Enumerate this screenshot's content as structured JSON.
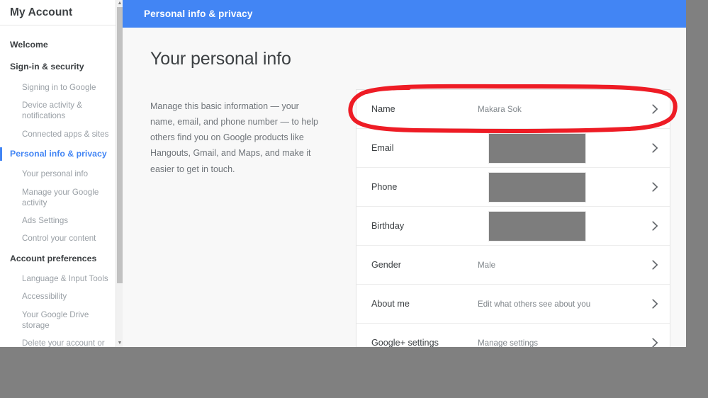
{
  "sidebar": {
    "brand": "My Account",
    "items": [
      {
        "label": "Welcome",
        "type": "group",
        "active": false
      },
      {
        "label": "Sign-in & security",
        "type": "group",
        "active": false
      },
      {
        "label": "Signing in to Google",
        "type": "sub"
      },
      {
        "label": "Device activity & notifications",
        "type": "sub"
      },
      {
        "label": "Connected apps & sites",
        "type": "sub"
      },
      {
        "label": "Personal info & privacy",
        "type": "group",
        "active": true
      },
      {
        "label": "Your personal info",
        "type": "sub"
      },
      {
        "label": "Manage your Google activity",
        "type": "sub"
      },
      {
        "label": "Ads Settings",
        "type": "sub"
      },
      {
        "label": "Control your content",
        "type": "sub"
      },
      {
        "label": "Account preferences",
        "type": "group",
        "active": false
      },
      {
        "label": "Language & Input Tools",
        "type": "sub"
      },
      {
        "label": "Accessibility",
        "type": "sub"
      },
      {
        "label": "Your Google Drive storage",
        "type": "sub"
      },
      {
        "label": "Delete your account or services",
        "type": "sub"
      }
    ],
    "scroll_up_glyph": "▲",
    "scroll_down_glyph": "▼"
  },
  "topbar": {
    "title": "Personal info & privacy",
    "background": "#4285f4"
  },
  "main": {
    "page_title": "Your personal info",
    "intro": "Manage this basic information — your name, email, and phone number — to help others find you on Google products like Hangouts, Gmail, and Maps, and make it easier to get in touch."
  },
  "card": {
    "rows": [
      {
        "label": "Name",
        "value": "Makara Sok",
        "redacted": false,
        "annotated": true
      },
      {
        "label": "Email",
        "value": "",
        "redacted": true,
        "annotated": false
      },
      {
        "label": "Phone",
        "value": "",
        "redacted": true,
        "annotated": false
      },
      {
        "label": "Birthday",
        "value": "",
        "redacted": true,
        "annotated": false
      },
      {
        "label": "Gender",
        "value": "Male",
        "redacted": false,
        "annotated": false
      },
      {
        "label": "About me",
        "value": "Edit what others see about you",
        "redacted": false,
        "annotated": false
      },
      {
        "label": "Google+ settings",
        "value": "Manage settings",
        "redacted": false,
        "annotated": false
      }
    ],
    "chevron_icon": "chevron-right-icon"
  },
  "annotation": {
    "shape": "hand-drawn-ellipse",
    "color": "#ee1c25",
    "target": "Name"
  }
}
